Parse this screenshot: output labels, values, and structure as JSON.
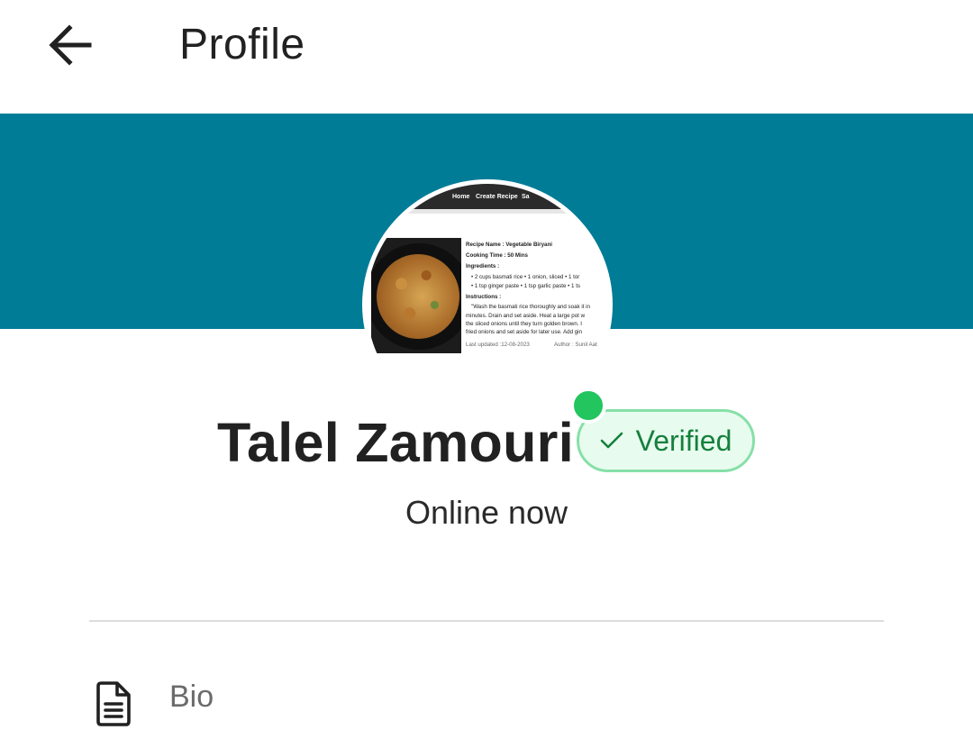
{
  "header": {
    "title": "Profile",
    "back_icon": "arrow-left-icon"
  },
  "colors": {
    "banner": "#007C97",
    "online": "#22C55E",
    "verified_text": "#15803D",
    "verified_border": "#86E0A8",
    "verified_bg": "#E8FBEF"
  },
  "avatar": {
    "nav": [
      "Home",
      "Create Recipe",
      "Sa"
    ],
    "recipe_name": "Recipe Name : Vegetable Biryani",
    "cooking_time": "Cooking Time : 50 Mins",
    "ingredients_label": "Ingredients :",
    "ingredient_line_1": "• 2 cups basmati rice • 1 onion, sliced • 1 tor",
    "ingredient_line_2": "• 1 tsp ginger paste • 1 tsp garlic paste • 1 ts",
    "instructions_label": "Instructions :",
    "instruction_line_1": "\"Wash the basmati rice thoroughly and soak it in",
    "instruction_line_2": "minutes. Drain and set aside. Heat a large pot w",
    "instruction_line_3": "the sliced onions until they turn golden brown. I",
    "instruction_line_4": "fried onions and set aside for later use. Add gin",
    "last_updated": "Last updated :12-08-2023",
    "author": "Author : Sunil Aat"
  },
  "profile": {
    "name": "Talel Zamouri",
    "badge": "Verified",
    "status": "Online now"
  },
  "bio": {
    "label": "Bio",
    "icon": "document-icon"
  }
}
